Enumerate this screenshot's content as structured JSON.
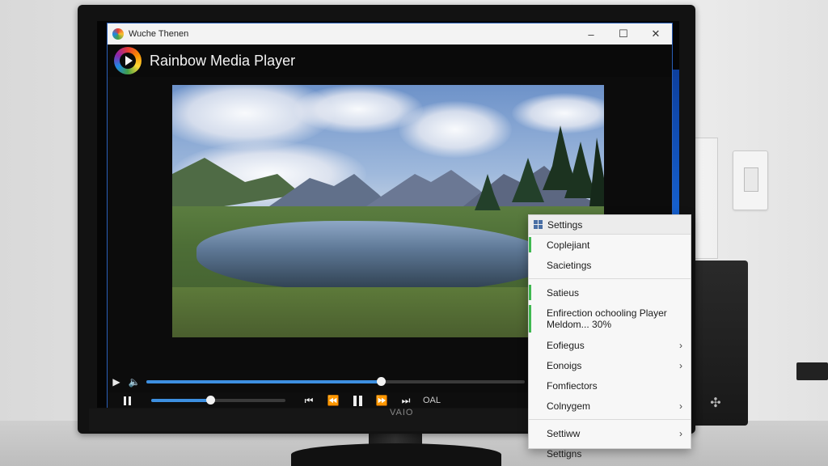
{
  "window": {
    "title": "Wuche Thenen",
    "minimize_glyph": "–",
    "maximize_glyph": "☐",
    "close_glyph": "✕"
  },
  "app": {
    "name": "Rainbow Media Player",
    "monitor_brand": "VAIO"
  },
  "playback": {
    "seek_progress": 0.62,
    "volume_level": 0.44,
    "volume_label": "OAL",
    "state": "playing"
  },
  "settings_menu": {
    "header": "Settings",
    "items": [
      {
        "label": "Coplejiant",
        "accent": true,
        "submenu": false
      },
      {
        "label": "Sacietings",
        "accent": false,
        "submenu": false
      },
      {
        "label": "Satieus",
        "accent": true,
        "submenu": false
      },
      {
        "label": "Enfirection ochooling Player",
        "sublabel": "Meldom... 30%",
        "accent": true,
        "submenu": false
      },
      {
        "label": "Eofiegus",
        "accent": false,
        "submenu": true
      },
      {
        "label": "Eonoigs",
        "accent": false,
        "submenu": true
      },
      {
        "label": "Fomfiectors",
        "accent": false,
        "submenu": false
      },
      {
        "label": "Colnygem",
        "accent": false,
        "submenu": true
      },
      {
        "label": "Settiww",
        "accent": false,
        "submenu": true
      },
      {
        "label": "Settigns",
        "accent": false,
        "submenu": false
      }
    ]
  },
  "icons": {
    "play": "play-icon",
    "volume": "volume-icon",
    "pause": "pause-icon",
    "prev": "skip-previous-icon",
    "rewind": "rewind-icon",
    "forward": "fast-forward-icon",
    "next": "skip-next-icon",
    "gear": "gear-icon"
  },
  "colors": {
    "accent_blue": "#3d8fe0",
    "menu_accent": "#3fb950",
    "window_border": "#2a5fb8"
  }
}
